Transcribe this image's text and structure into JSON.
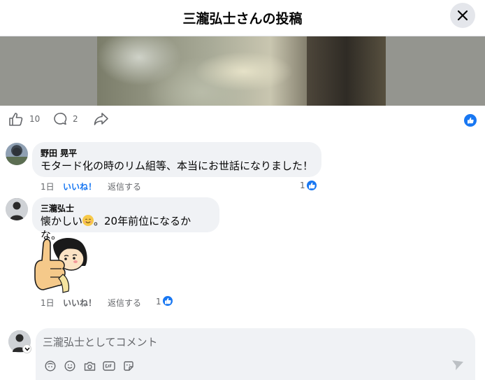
{
  "header": {
    "title": "三瀧弘士さんの投稿"
  },
  "reactions": {
    "like_count": "10",
    "comment_count": "2"
  },
  "comments": [
    {
      "author": "野田 晃平",
      "text": "モタード化の時のリム組等、本当にお世話になりました！",
      "time": "1日",
      "like_label": "いいね！",
      "reply_label": "返信する",
      "reaction_count": "1"
    },
    {
      "author": "三瀧弘士",
      "text_before": "懐かしい",
      "text_after": "。20年前位になるかな。",
      "time": "1日",
      "like_label": "いいね！",
      "reply_label": "返信する",
      "reaction_count": "1"
    }
  ],
  "composer": {
    "placeholder": "三瀧弘士としてコメント"
  },
  "icons": [
    "close-icon",
    "like-icon",
    "comment-icon",
    "share-icon",
    "thumbs-up-icon",
    "avatar-icon",
    "sticker-icon",
    "emoji-icon",
    "camera-icon",
    "gif-icon",
    "send-icon"
  ],
  "colors": {
    "accent": "#1877f2",
    "bubble": "#f0f2f5",
    "muted": "#65676b"
  }
}
